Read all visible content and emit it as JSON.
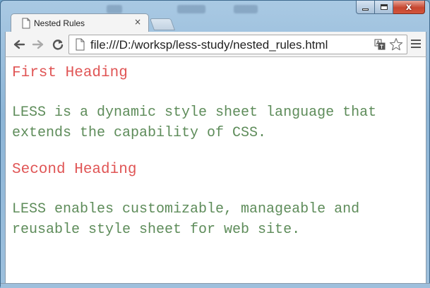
{
  "window": {
    "tab_title": "Nested Rules",
    "tab_close": "×",
    "controls": {
      "minimize": "",
      "maximize": "",
      "close": "x"
    }
  },
  "toolbar": {
    "url": "file:///D:/worksp/less-study/nested_rules.html",
    "back_icon": "arrow-left-icon",
    "forward_icon": "arrow-right-icon",
    "reload_icon": "reload-icon",
    "page_icon": "document-icon",
    "translate_icon": "translate-icon",
    "star_icon": "star-icon",
    "menu_icon": "hamburger-menu-icon"
  },
  "page": {
    "heading1": "First Heading",
    "paragraph1_line1": "LESS is a dynamic style sheet language that",
    "paragraph1_line2": "extends the capability of CSS.",
    "heading2": "Second Heading",
    "paragraph2_line1": "LESS enables customizable, manageable and",
    "paragraph2_line2": "reusable style sheet for web site."
  },
  "colors": {
    "heading": "#e05555",
    "paragraph": "#5e8c5a"
  }
}
